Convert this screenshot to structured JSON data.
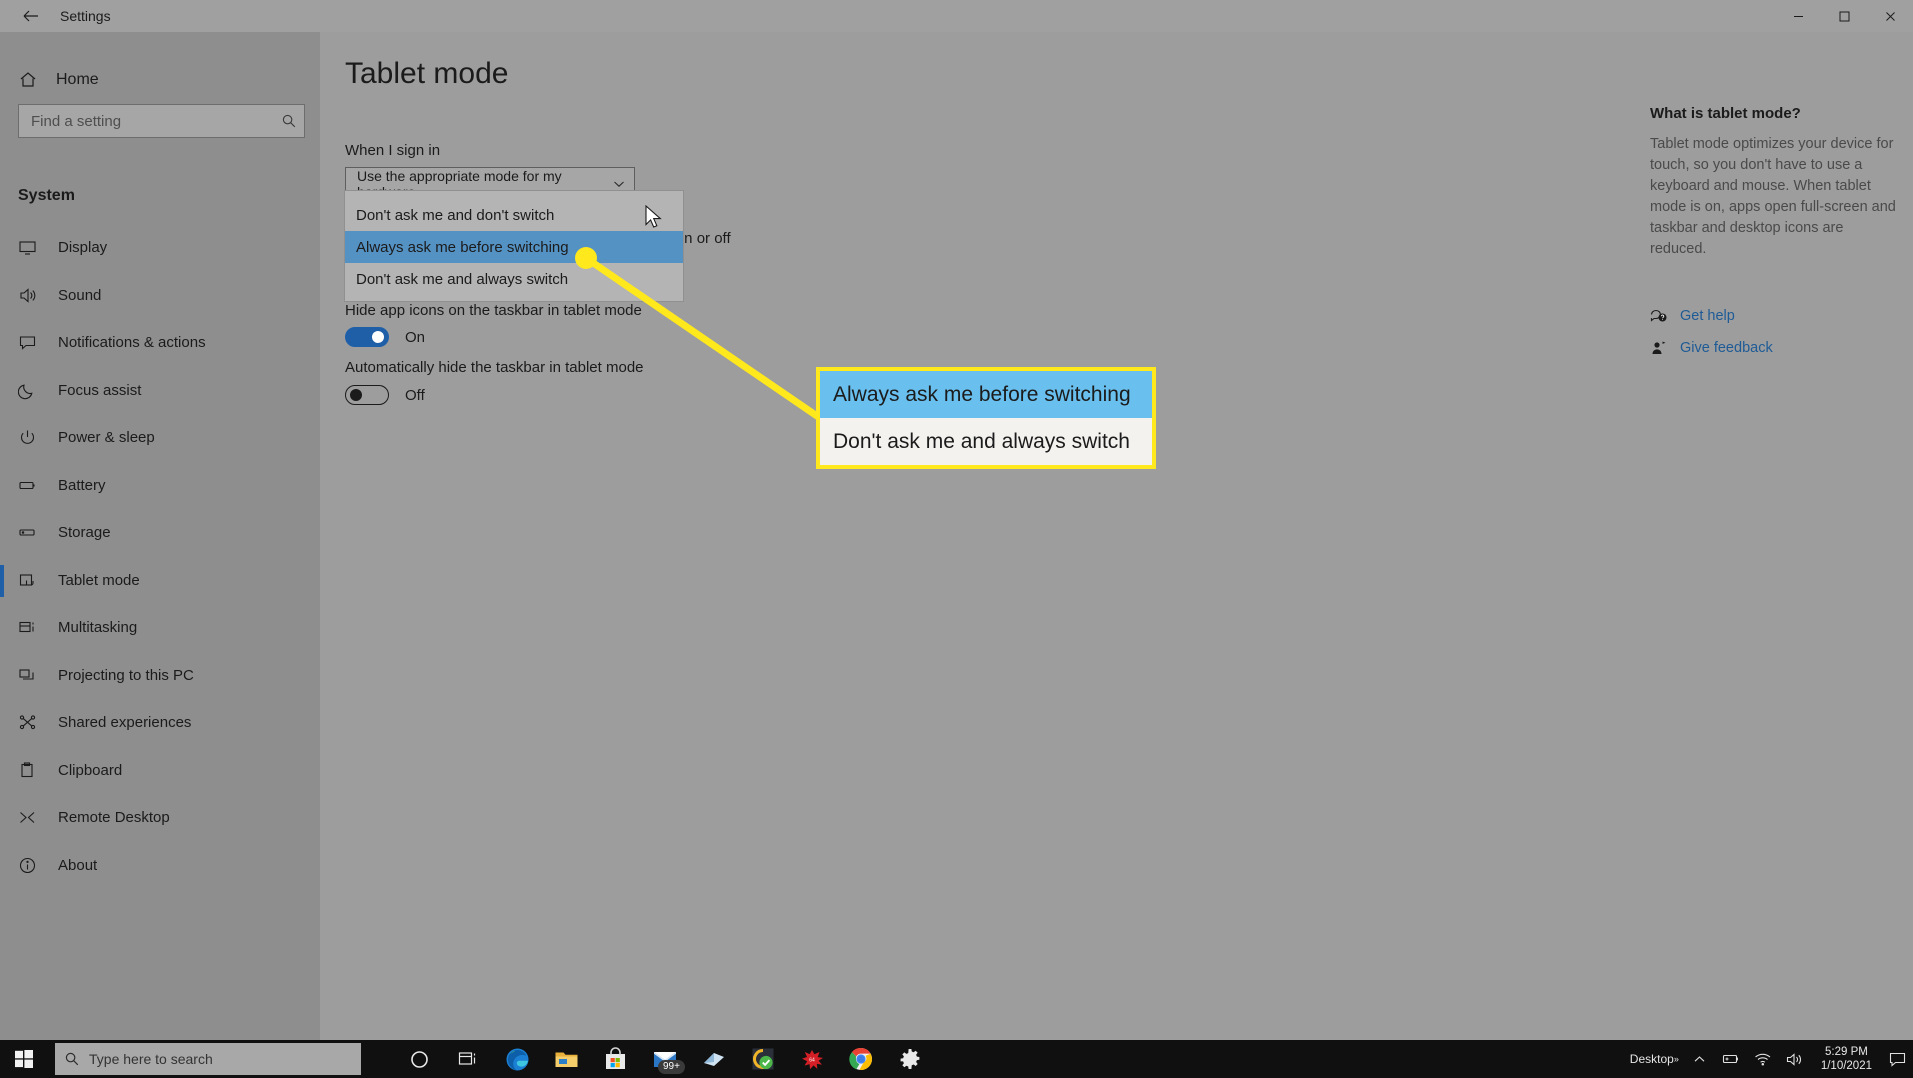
{
  "window": {
    "title": "Settings",
    "back_icon": "back-arrow-icon",
    "minimize_label": "—",
    "maximize_label": "□",
    "close_label": "✕"
  },
  "sidebar": {
    "home_label": "Home",
    "home_icon": "home-icon",
    "search": {
      "placeholder": "Find a setting",
      "value": "",
      "icon": "search-icon"
    },
    "group_label": "System",
    "items": [
      {
        "label": "Display",
        "icon": "monitor-icon",
        "selected": false
      },
      {
        "label": "Sound",
        "icon": "speaker-icon",
        "selected": false
      },
      {
        "label": "Notifications & actions",
        "icon": "chat-bubble-icon",
        "selected": false
      },
      {
        "label": "Focus assist",
        "icon": "moon-icon",
        "selected": false
      },
      {
        "label": "Power & sleep",
        "icon": "power-icon",
        "selected": false
      },
      {
        "label": "Battery",
        "icon": "battery-icon",
        "selected": false
      },
      {
        "label": "Storage",
        "icon": "drive-icon",
        "selected": false
      },
      {
        "label": "Tablet mode",
        "icon": "tablet-hand-icon",
        "selected": true
      },
      {
        "label": "Multitasking",
        "icon": "multitask-icon",
        "selected": false
      },
      {
        "label": "Projecting to this PC",
        "icon": "project-icon",
        "selected": false
      },
      {
        "label": "Shared experiences",
        "icon": "share-nodes-icon",
        "selected": false
      },
      {
        "label": "Clipboard",
        "icon": "clipboard-icon",
        "selected": false
      },
      {
        "label": "Remote Desktop",
        "icon": "remote-desktop-icon",
        "selected": false
      },
      {
        "label": "About",
        "icon": "info-icon",
        "selected": false
      }
    ]
  },
  "main": {
    "page_title": "Tablet mode",
    "when_i_sign_in_label": "When I sign in",
    "combo": {
      "value": "Use the appropriate mode for my hardware",
      "chevron_icon": "chevron-down-icon",
      "options": [
        "Don't ask me and don't switch",
        "Always ask me before switching",
        "Don't ask me and always switch"
      ],
      "highlighted_option": "Always ask me before switching"
    },
    "occluded_text": "le on or off",
    "settings": [
      {
        "label": "Hide app icons on the taskbar in tablet mode",
        "state": "On",
        "on": true
      },
      {
        "label": "Automatically hide the taskbar in tablet mode",
        "state": "Off",
        "on": false
      }
    ]
  },
  "help": {
    "heading": "What is tablet mode?",
    "body": "Tablet mode optimizes your device for touch, so you don't have to use a keyboard and mouse. When tablet mode is on, apps open full-screen and taskbar and desktop icons are reduced.",
    "links": [
      {
        "label": "Get help",
        "icon": "help-question-icon"
      },
      {
        "label": "Give feedback",
        "icon": "feedback-person-icon"
      }
    ]
  },
  "annotation": {
    "accent_color": "#ffe81c",
    "highlight_color": "#69c0ef",
    "rows": [
      {
        "text": "Always ask me before switching",
        "highlighted": true
      },
      {
        "text": "Don't ask me and always switch",
        "highlighted": false
      }
    ]
  },
  "taskbar": {
    "start_icon": "windows-logo-icon",
    "search": {
      "placeholder": "Type here to search",
      "icon": "search-icon"
    },
    "items": [
      {
        "name": "cortana-icon",
        "badge": ""
      },
      {
        "name": "task-view-icon",
        "badge": ""
      },
      {
        "name": "microsoft-edge-icon",
        "badge": ""
      },
      {
        "name": "file-explorer-icon",
        "badge": ""
      },
      {
        "name": "microsoft-store-icon",
        "badge": ""
      },
      {
        "name": "mail-icon",
        "badge": "99+"
      },
      {
        "name": "sticky-notes-icon",
        "badge": ""
      },
      {
        "name": "office-check-icon",
        "badge": ""
      },
      {
        "name": "red-splat-icon",
        "badge": ""
      },
      {
        "name": "google-chrome-icon",
        "badge": ""
      },
      {
        "name": "settings-gear-icon",
        "badge": ""
      }
    ],
    "tray": {
      "desktop_label": "Desktop",
      "overflow_icon": "chevron-up-icon",
      "battery_icon": "battery-icon",
      "wifi_icon": "wifi-icon",
      "volume_icon": "volume-icon",
      "time": "5:29 PM",
      "date": "1/10/2021",
      "action_center_icon": "notification-icon"
    }
  },
  "colors": {
    "accent_blue": "#1f5fa8",
    "link_blue": "#1e5b96",
    "dropdown_highlight": "#5592c4",
    "annotation_yellow": "#ffe81c"
  }
}
